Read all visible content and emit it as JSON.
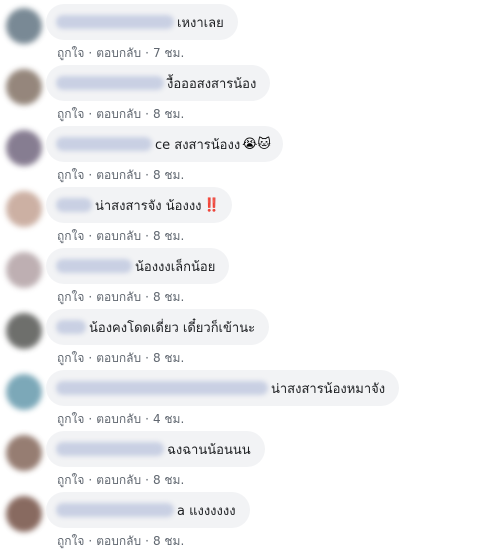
{
  "comments": [
    {
      "text": "เหงาเลย",
      "emoji": "",
      "like": "ถูกใจ",
      "sep": "·",
      "reply": "ตอบกลับ",
      "time": "7 ชม."
    },
    {
      "text": "งื้อออสงสารน้อง",
      "emoji": "",
      "like": "ถูกใจ",
      "sep": "·",
      "reply": "ตอบกลับ",
      "time": "8 ชม."
    },
    {
      "text": "ce สงสารน้องง",
      "emoji": "😭🐱",
      "like": "ถูกใจ",
      "sep": "·",
      "reply": "ตอบกลับ",
      "time": "8 ชม."
    },
    {
      "text": "น่าสงสารจัง น้องงง",
      "emoji": "‼️",
      "like": "ถูกใจ",
      "sep": "·",
      "reply": "ตอบกลับ",
      "time": "8 ชม."
    },
    {
      "text": "น้องงงเล็กน้อย",
      "emoji": "",
      "like": "ถูกใจ",
      "sep": "·",
      "reply": "ตอบกลับ",
      "time": "8 ชม."
    },
    {
      "text": "น้องคงโดดเดี่ยว เดี๋ยวก็เข้านะ",
      "emoji": "",
      "like": "ถูกใจ",
      "sep": "·",
      "reply": "ตอบกลับ",
      "time": "8 ชม."
    },
    {
      "text": "น่าสงสารน้องหมาจัง",
      "emoji": "",
      "like": "ถูกใจ",
      "sep": "·",
      "reply": "ตอบกลับ",
      "time": "4 ชม."
    },
    {
      "text": "ฉงฉานน้อนนน",
      "emoji": "",
      "like": "ถูกใจ",
      "sep": "·",
      "reply": "ตอบกลับ",
      "time": "8 ชม."
    },
    {
      "text": "a แงงงงงง",
      "emoji": "",
      "like": "ถูกใจ",
      "sep": "·",
      "reply": "ตอบกลับ",
      "time": "8 ชม."
    }
  ]
}
